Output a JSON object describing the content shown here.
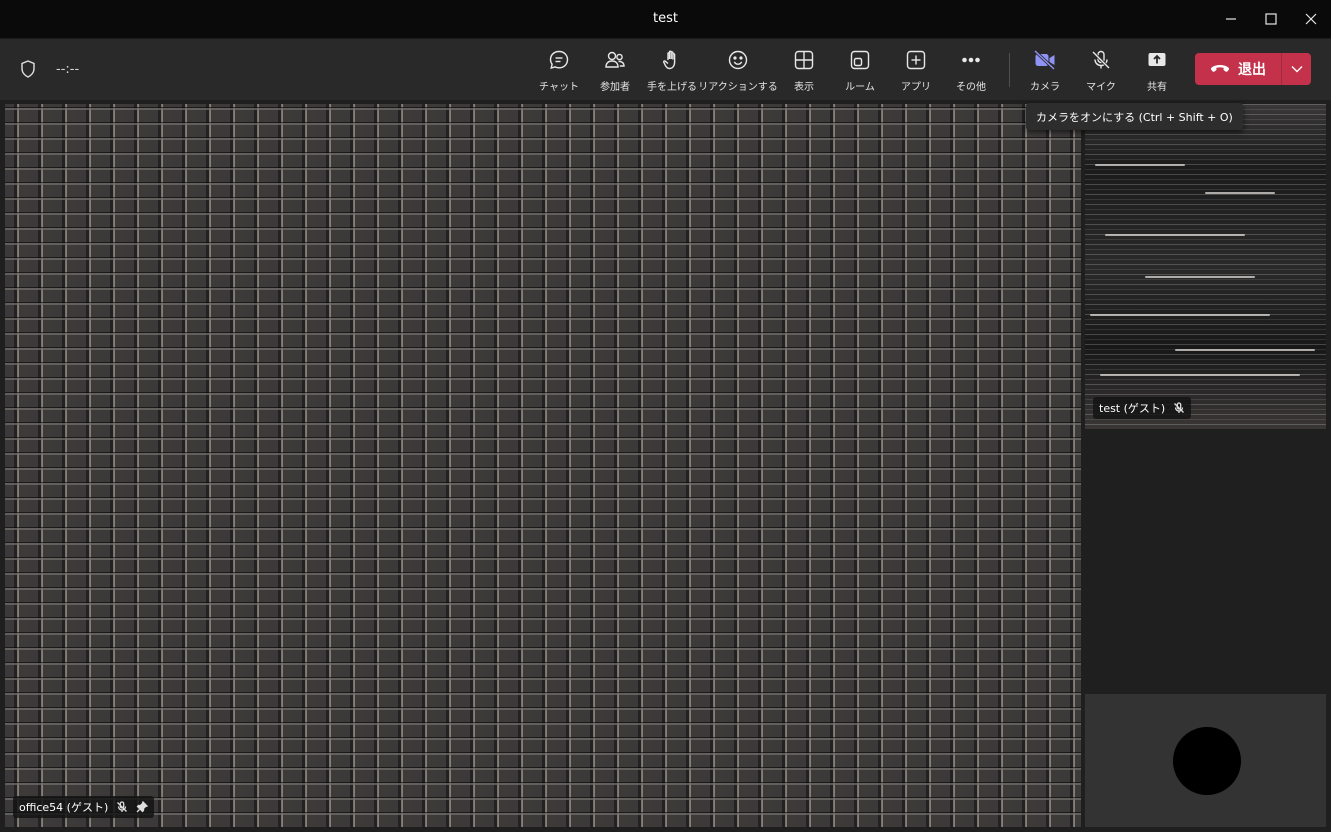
{
  "window": {
    "title": "test"
  },
  "toolbar": {
    "timer": "--:--",
    "buttons": {
      "chat": "チャット",
      "participants": "参加者",
      "raise_hand": "手を上げる",
      "reactions": "リアクションする",
      "view": "表示",
      "rooms": "ルーム",
      "apps": "アプリ",
      "more": "その他",
      "camera": "カメラ",
      "mic": "マイク",
      "share": "共有"
    },
    "leave_label": "退出"
  },
  "tooltip": {
    "text": "カメラをオンにする (Ctrl + Shift + O)"
  },
  "participants": {
    "main": {
      "name": "office54 (ゲスト)"
    },
    "side": {
      "name": "test (ゲスト)"
    }
  },
  "colors": {
    "leave_red": "#c4314b",
    "camera_accent": "#8f93f4",
    "toolbar_bg": "#292929"
  }
}
